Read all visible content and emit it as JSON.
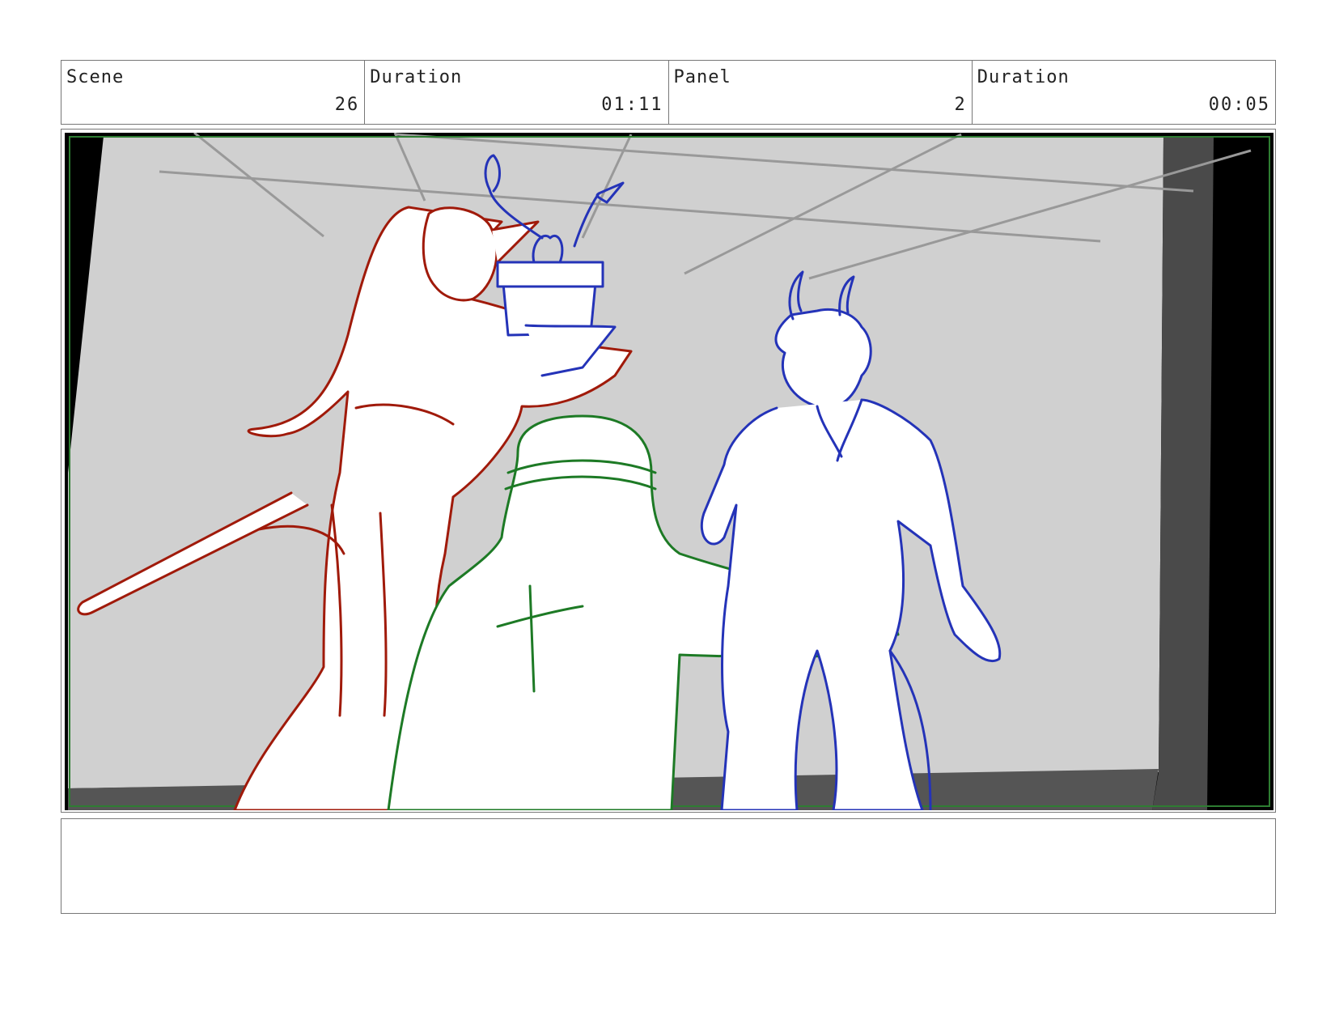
{
  "header": {
    "scene_label": "Scene",
    "scene_value": "26",
    "scene_duration_label": "Duration",
    "scene_duration_value": "01:11",
    "panel_label": "Panel",
    "panel_value": "2",
    "panel_duration_label": "Duration",
    "panel_duration_value": "00:05"
  },
  "colors": {
    "elf_sketch": "#a01a0a",
    "horned_sketch": "#2433b8",
    "foreground_sketch": "#1d7a25",
    "frame_guide": "#2e7d32",
    "background_wall": "#d0d0d0",
    "ceiling_lines": "#999999"
  },
  "notes": {
    "text": ""
  }
}
